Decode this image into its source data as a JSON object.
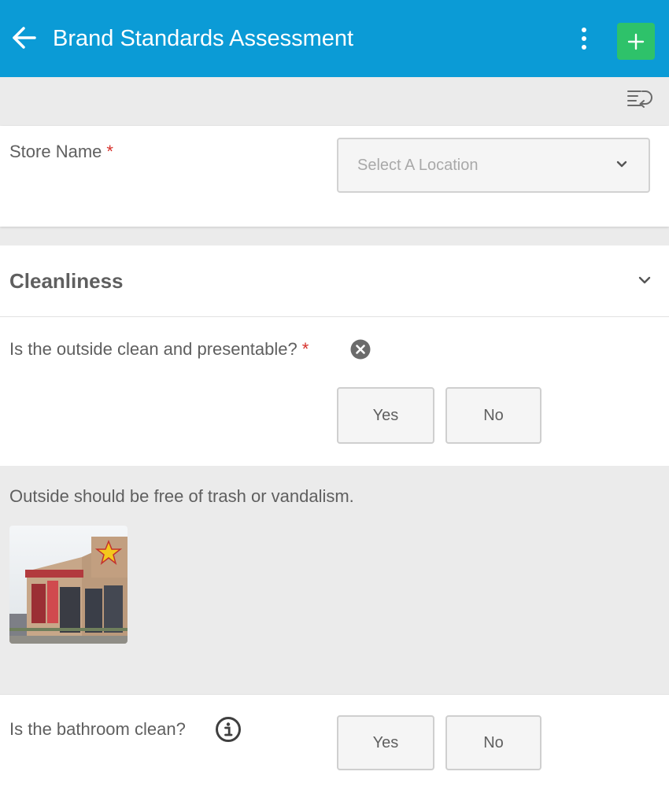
{
  "header": {
    "title": "Brand Standards Assessment",
    "back_icon": "arrow-left-icon",
    "menu_icon": "more-vertical-icon",
    "add_icon": "plus-icon",
    "bar_color": "#0b9bd6",
    "add_color": "#2ec26a"
  },
  "toolbar": {
    "sort_icon": "list-reorder-icon"
  },
  "store_field": {
    "label": "Store Name",
    "required_mark": "*",
    "placeholder": "Select A Location"
  },
  "section": {
    "title": "Cleanliness",
    "questions": [
      {
        "text": "Is the outside clean and presentable?",
        "required_mark": "*",
        "status_icon": "clear-circle-icon",
        "yes_label": "Yes",
        "no_label": "No",
        "hint": "Outside should be free of trash or vandalism.",
        "image_icon": "store-photo"
      },
      {
        "text": "Is the bathroom clean?",
        "info_icon": "info-circle-icon",
        "yes_label": "Yes",
        "no_label": "No"
      }
    ]
  },
  "colors": {
    "required": "#d6302a",
    "text": "#5f5f5f"
  }
}
